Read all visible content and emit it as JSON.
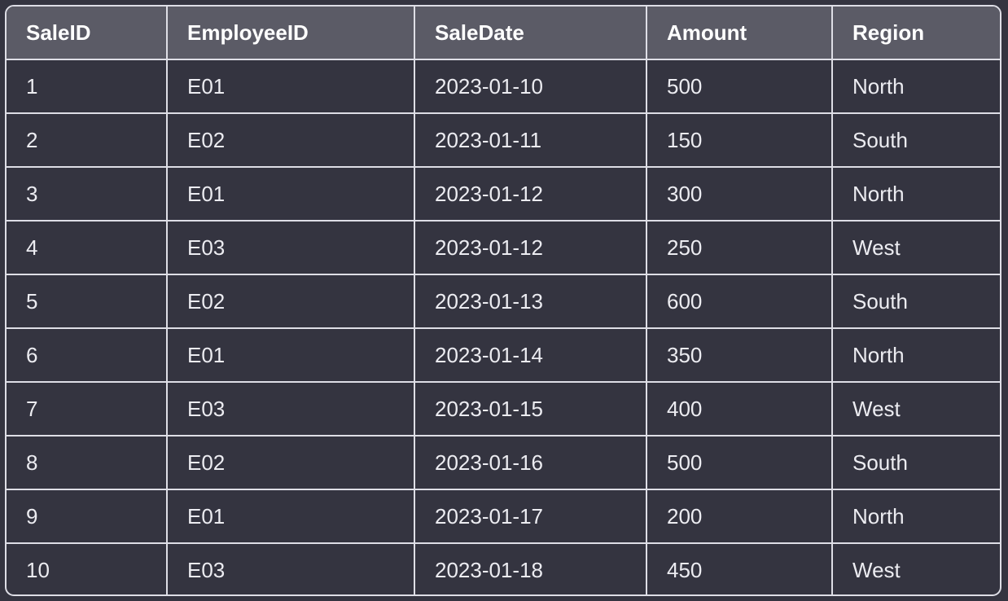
{
  "table": {
    "columns": [
      "SaleID",
      "EmployeeID",
      "SaleDate",
      "Amount",
      "Region"
    ],
    "rows": [
      [
        "1",
        "E01",
        "2023-01-10",
        "500",
        "North"
      ],
      [
        "2",
        "E02",
        "2023-01-11",
        "150",
        "South"
      ],
      [
        "3",
        "E01",
        "2023-01-12",
        "300",
        "North"
      ],
      [
        "4",
        "E03",
        "2023-01-12",
        "250",
        "West"
      ],
      [
        "5",
        "E02",
        "2023-01-13",
        "600",
        "South"
      ],
      [
        "6",
        "E01",
        "2023-01-14",
        "350",
        "North"
      ],
      [
        "7",
        "E03",
        "2023-01-15",
        "400",
        "West"
      ],
      [
        "8",
        "E02",
        "2023-01-16",
        "500",
        "South"
      ],
      [
        "9",
        "E01",
        "2023-01-17",
        "200",
        "North"
      ],
      [
        "10",
        "E03",
        "2023-01-18",
        "450",
        "West"
      ]
    ]
  },
  "colors": {
    "background": "#343440",
    "header_background": "#5b5b66",
    "border": "#dedee6",
    "text": "#ececf1"
  }
}
